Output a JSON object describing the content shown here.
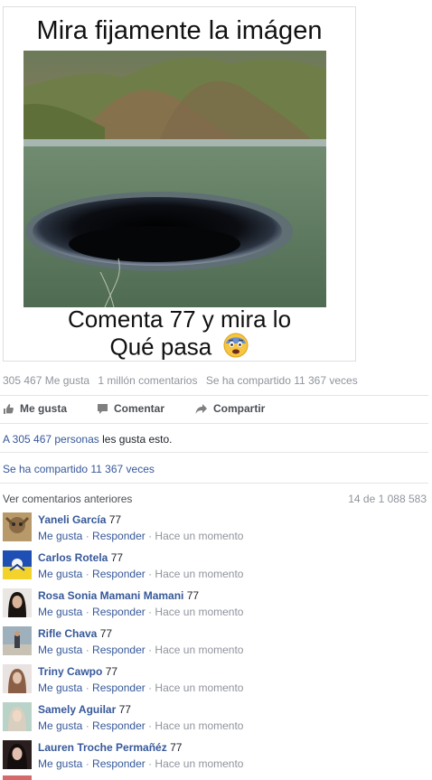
{
  "post": {
    "image_title": "Mira fijamente la imágen",
    "caption_line1": "Comenta 77 y mira lo",
    "caption_line2": "Qué pasa",
    "emoji_icon": "fearful-face-emoji"
  },
  "stats": {
    "likes": "305 467 Me gusta",
    "comments": "1 millón comentarios",
    "shares": "Se ha compartido 11 367 veces"
  },
  "actions": {
    "like": "Me gusta",
    "comment": "Comentar",
    "share": "Compartir"
  },
  "summary": {
    "likes_link": "A 305 467 personas",
    "likes_tail": " les gusta esto.",
    "shares": "Se ha compartido 11 367 veces"
  },
  "comments_header": {
    "previous": "Ver comentarios anteriores",
    "count": "14 de 1 088 583"
  },
  "comments": [
    {
      "name": "Yaneli García",
      "text": "77",
      "like": "Me gusta",
      "reply": "Responder",
      "time": "Hace un momento"
    },
    {
      "name": "Carlos Rotela",
      "text": "77",
      "like": "Me gusta",
      "reply": "Responder",
      "time": "Hace un momento"
    },
    {
      "name": "Rosa Sonia Mamani Mamani",
      "text": "77",
      "like": "Me gusta",
      "reply": "Responder",
      "time": "Hace un momento"
    },
    {
      "name": "Rifle Chava",
      "text": "77",
      "like": "Me gusta",
      "reply": "Responder",
      "time": "Hace un momento"
    },
    {
      "name": "Triny Cawpo",
      "text": "77",
      "like": "Me gusta",
      "reply": "Responder",
      "time": "Hace un momento"
    },
    {
      "name": "Samely Aguilar",
      "text": "77",
      "like": "Me gusta",
      "reply": "Responder",
      "time": "Hace un momento"
    },
    {
      "name": "Lauren Troche Permañéz",
      "text": "77",
      "like": "Me gusta",
      "reply": "Responder",
      "time": "Hace un momento"
    }
  ],
  "colors": {
    "link": "#365899",
    "muted": "#90949c"
  }
}
